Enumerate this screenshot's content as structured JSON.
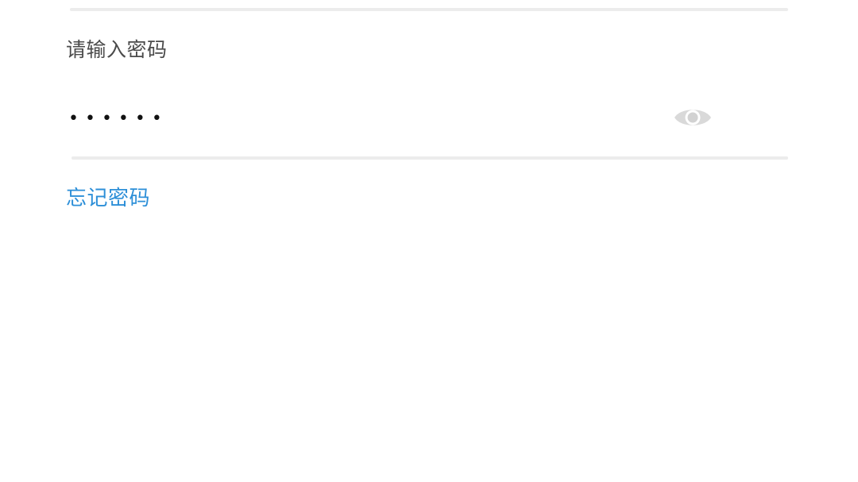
{
  "password_form": {
    "label": "请输入密码",
    "value": "••••••",
    "visibility_toggle_icon": "eye-icon",
    "forgot_link": "忘记密码"
  },
  "colors": {
    "label": "#4b4b4b",
    "link": "#2d8fd8",
    "divider": "#ececec",
    "icon": "#d9d9d9"
  }
}
